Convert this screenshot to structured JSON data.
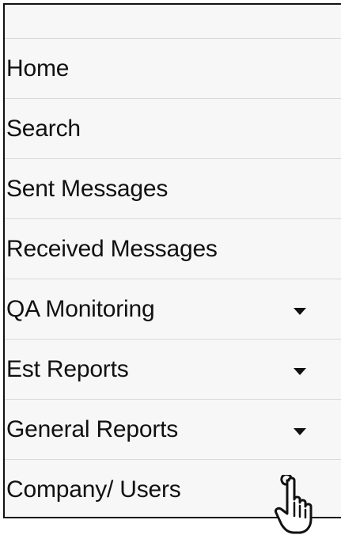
{
  "menu": {
    "items": [
      {
        "label": "Home",
        "has_dropdown": false
      },
      {
        "label": "Search",
        "has_dropdown": false
      },
      {
        "label": "Sent Messages",
        "has_dropdown": false
      },
      {
        "label": "Received Messages",
        "has_dropdown": false
      },
      {
        "label": "QA Monitoring",
        "has_dropdown": true
      },
      {
        "label": "Est Reports",
        "has_dropdown": true
      },
      {
        "label": "General Reports",
        "has_dropdown": true
      },
      {
        "label": "Company/ Users",
        "has_dropdown": false
      }
    ]
  },
  "cursor": {
    "icon": "hand-pointer-icon"
  },
  "colors": {
    "panel_background": "#f7f7f7",
    "panel_border": "#111111",
    "divider": "#d9d9d9",
    "text": "#111111"
  }
}
